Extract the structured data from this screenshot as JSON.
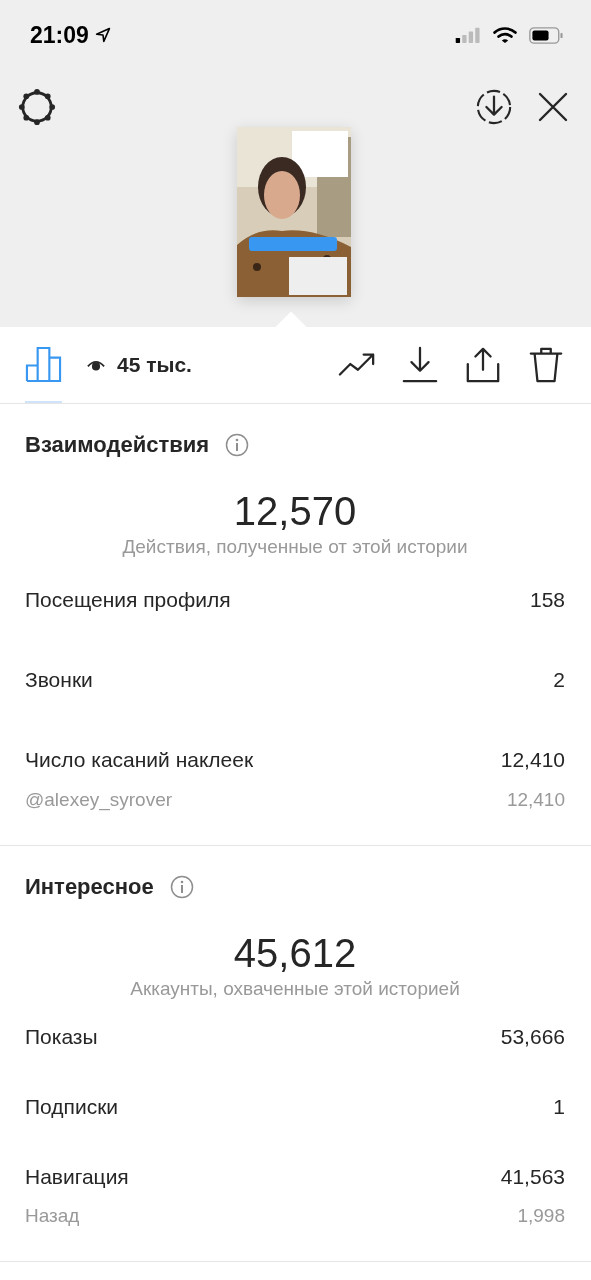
{
  "status_bar": {
    "time": "21:09"
  },
  "toolbar": {
    "tabs": [
      {
        "kind": "chart",
        "selected": true
      }
    ],
    "views": "45 тыс."
  },
  "sections": [
    {
      "title": "Взаимодействия",
      "total": "12,570",
      "caption": "Действия, полученные от этой истории",
      "rows": [
        {
          "kind": "main",
          "label": "Посещения профиля",
          "value": "158"
        },
        {
          "kind": "main",
          "label": "Звонки",
          "value": "2"
        },
        {
          "kind": "main",
          "label": "Число касаний наклеек",
          "value": "12,410"
        },
        {
          "kind": "sub",
          "label": "@alexey_syrover",
          "value": "12,410"
        }
      ]
    },
    {
      "title": "Интересное",
      "total": "45,612",
      "caption": "Аккаунты, охваченные этой историей",
      "rows": [
        {
          "kind": "main",
          "label": "Показы",
          "value": "53,666"
        },
        {
          "kind": "main",
          "label": "Подписки",
          "value": "1"
        },
        {
          "kind": "main",
          "label": "Навигация",
          "value": "41,563"
        },
        {
          "kind": "sub",
          "label": "Назад",
          "value": "1,998"
        }
      ]
    }
  ]
}
